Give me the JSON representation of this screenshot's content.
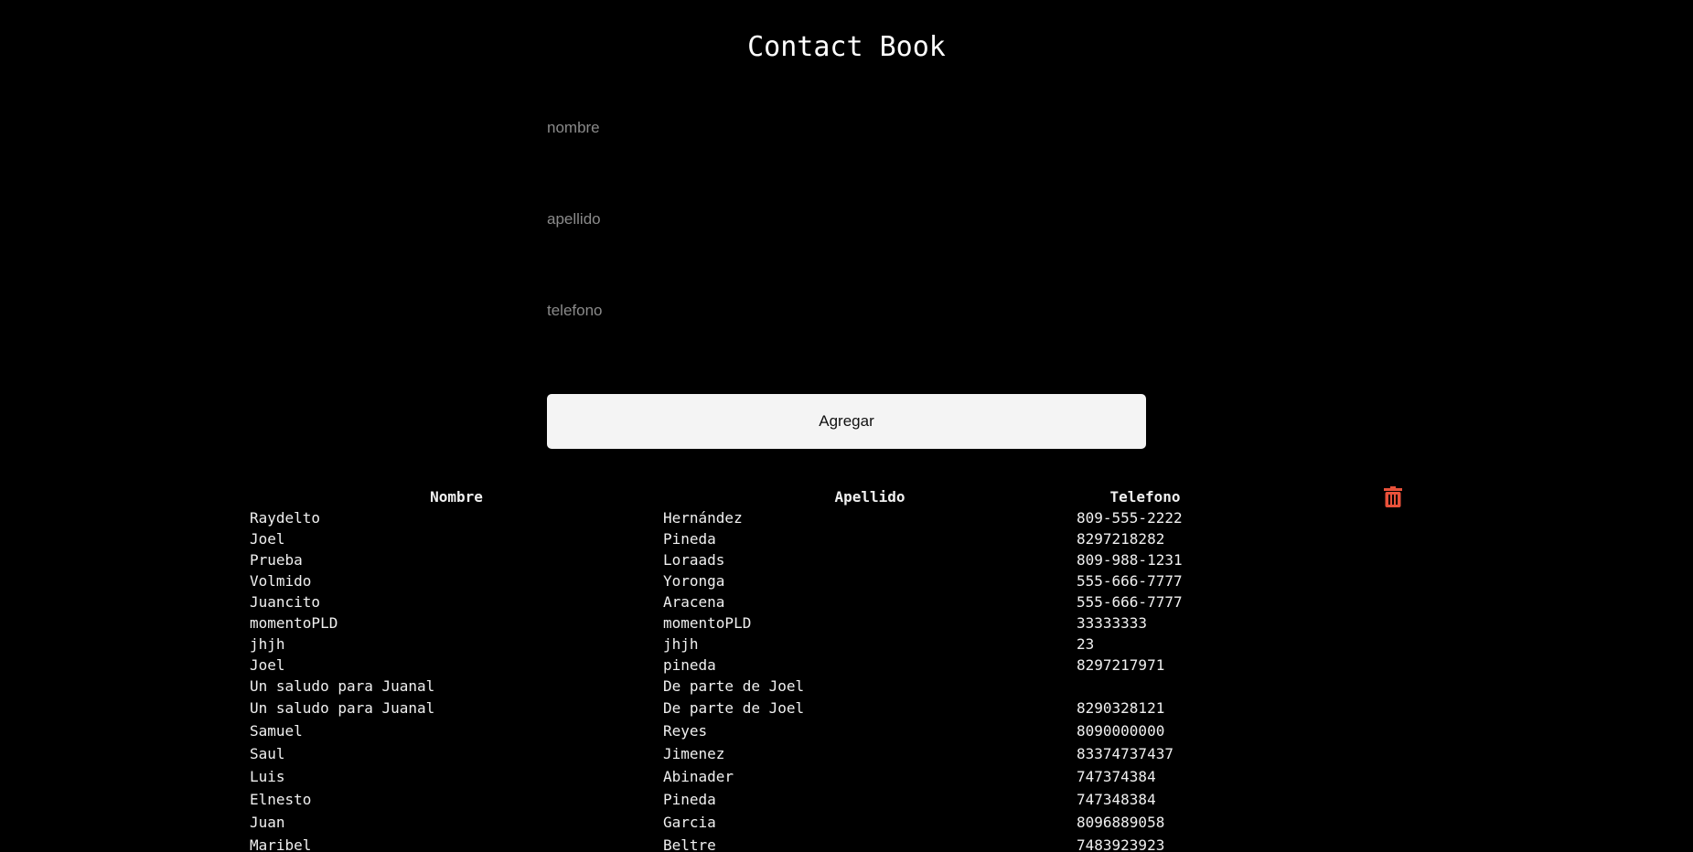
{
  "header": {
    "title": "Contact Book"
  },
  "form": {
    "nombre_placeholder": "nombre",
    "apellido_placeholder": "apellido",
    "telefono_placeholder": "telefono",
    "add_label": "Agregar"
  },
  "table": {
    "headers": {
      "nombre": "Nombre",
      "apellido": "Apellido",
      "telefono": "Telefono"
    },
    "delete_icon": "trash-icon",
    "delete_color": "#e8513a",
    "rows": [
      {
        "nombre": "Raydelto",
        "apellido": "Hernández",
        "telefono": "809-555-2222"
      },
      {
        "nombre": "Joel",
        "apellido": "Pineda",
        "telefono": "8297218282"
      },
      {
        "nombre": "Prueba",
        "apellido": "Loraads",
        "telefono": "809-988-1231"
      },
      {
        "nombre": "Volmido",
        "apellido": "Yoronga",
        "telefono": "555-666-7777"
      },
      {
        "nombre": "Juancito",
        "apellido": "Aracena",
        "telefono": "555-666-7777"
      },
      {
        "nombre": "momentoPLD",
        "apellido": "momentoPLD",
        "telefono": "33333333"
      },
      {
        "nombre": "jhjh",
        "apellido": "jhjh",
        "telefono": "23"
      },
      {
        "nombre": "Joel",
        "apellido": "pineda",
        "telefono": "8297217971"
      },
      {
        "nombre": "Un saludo para Juanal",
        "apellido": "De parte de Joel",
        "telefono": ""
      },
      {
        "nombre": "Un saludo para Juanal",
        "apellido": "De parte de Joel",
        "telefono": "8290328121"
      },
      {
        "nombre": "Samuel",
        "apellido": "Reyes",
        "telefono": "8090000000"
      },
      {
        "nombre": "Saul",
        "apellido": "Jimenez",
        "telefono": "83374737437"
      },
      {
        "nombre": "Luis",
        "apellido": "Abinader",
        "telefono": "747374384"
      },
      {
        "nombre": "Elnesto",
        "apellido": "Pineda",
        "telefono": "747348384"
      },
      {
        "nombre": "Juan",
        "apellido": "Garcia",
        "telefono": "8096889058"
      },
      {
        "nombre": "Maribel",
        "apellido": "Beltre",
        "telefono": "7483923923"
      }
    ]
  }
}
